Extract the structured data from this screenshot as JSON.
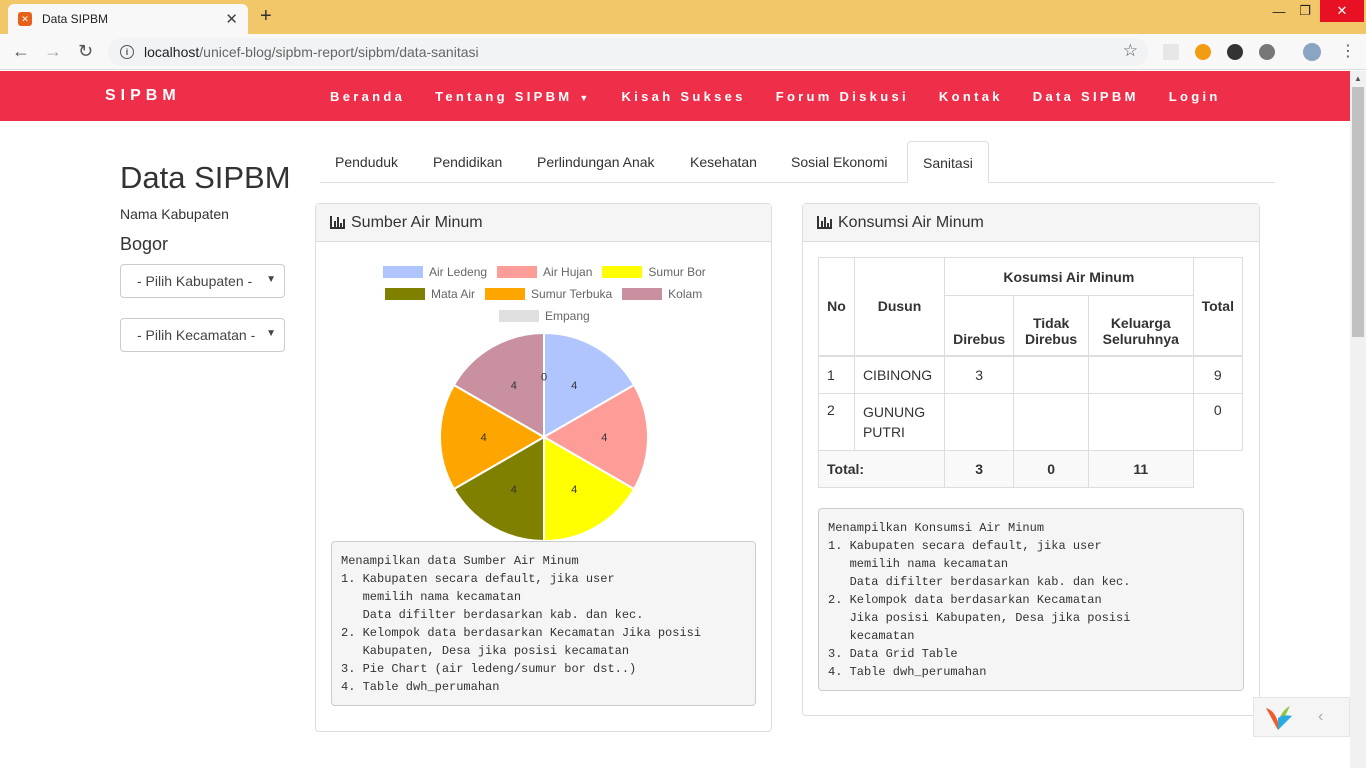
{
  "browser": {
    "tab_title": "Data SIPBM",
    "url_host": "localhost",
    "url_path": "/unicef-blog/sipbm-report/sipbm/data-sanitasi"
  },
  "nav": {
    "brand": "SIPBM",
    "links": [
      "Beranda",
      "Tentang SIPBM",
      "Kisah Sukses",
      "Forum Diskusi",
      "Kontak",
      "Data SIPBM",
      "Login"
    ]
  },
  "sidebar": {
    "title": "Data SIPBM",
    "label": "Nama Kabupaten",
    "kabupaten": "Bogor",
    "select_kabupaten": "- Pilih Kabupaten -",
    "select_kecamatan": "- Pilih Kecamatan -"
  },
  "tabs": [
    "Penduduk",
    "Pendidikan",
    "Perlindungan Anak",
    "Kesehatan",
    "Sosial Ekonomi",
    "Sanitasi"
  ],
  "panel_left": {
    "title": "Sumber Air Minum",
    "note": "Menampilkan data Sumber Air Minum\n1. Kabupaten secara default, jika user\n   memilih nama kecamatan\n   Data difilter berdasarkan kab. dan kec.\n2. Kelompok data berdasarkan Kecamatan Jika posisi\n   Kabupaten, Desa jika posisi kecamatan\n3. Pie Chart (air ledeng/sumur bor dst..)\n4. Table dwh_perumahan"
  },
  "chart_data": {
    "type": "pie",
    "categories": [
      "Air Ledeng",
      "Air Hujan",
      "Sumur Bor",
      "Mata Air",
      "Sumur Terbuka",
      "Kolam",
      "Empang"
    ],
    "values": [
      4,
      4,
      4,
      4,
      4,
      4,
      0
    ],
    "colors": [
      "#b0c4fe",
      "#fe9c98",
      "#ffff00",
      "#808000",
      "#ffa500",
      "#c9909f",
      "#e0e0e0"
    ],
    "legend": "top"
  },
  "panel_right": {
    "title": "Konsumsi Air Minum",
    "headers": {
      "no": "No",
      "dusun": "Dusun",
      "group": "Kosumsi Air Minum",
      "direbus": "Direbus",
      "tidak_direbus": "Tidak Direbus",
      "keluarga": "Keluarga Seluruhnya",
      "total": "Total"
    },
    "rows": [
      {
        "no": "1",
        "dusun": "CIBINONG",
        "direbus": "3",
        "tidak": "",
        "keluarga": "",
        "total": "9"
      },
      {
        "no": "2",
        "dusun": "GUNUNG PUTRI",
        "direbus": "",
        "tidak": "",
        "keluarga": "",
        "total": "0"
      }
    ],
    "footer": {
      "label": "Total:",
      "direbus": "3",
      "tidak": "0",
      "keluarga": "11"
    },
    "note": "Menampilkan Konsumsi Air Minum\n1. Kabupaten secara default, jika user\n   memilih nama kecamatan\n   Data difilter berdasarkan kab. dan kec.\n2. Kelompok data berdasarkan Kecamatan\n   Jika posisi Kabupaten, Desa jika posisi\n   kecamatan\n3. Data Grid Table\n4. Table dwh_perumahan"
  }
}
